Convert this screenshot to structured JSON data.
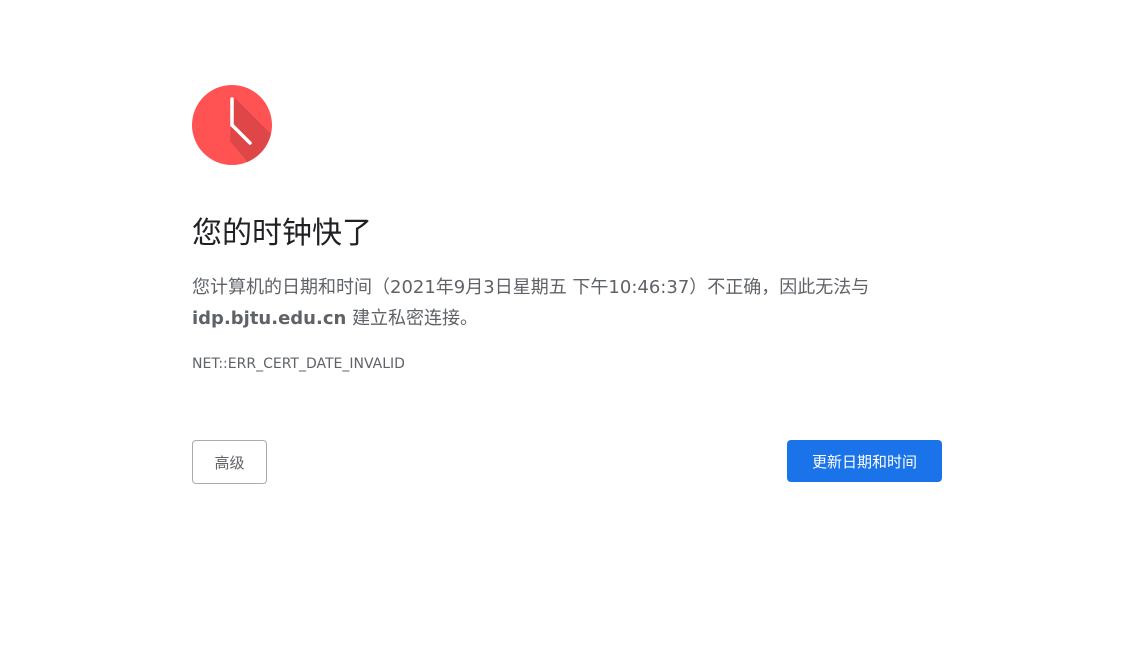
{
  "interstitial": {
    "title": "您的时钟快了",
    "message_part1": "您计算机的日期和时间（2021年9月3日星期五 下午10:46:37）不正确，因此无法与",
    "host": "idp.bjtu.edu.cn",
    "message_part2": "建立私密连接。",
    "error_code": "NET::ERR_CERT_DATE_INVALID",
    "icon": "clock-icon"
  },
  "buttons": {
    "advanced_label": "高级",
    "update_label": "更新日期和时间"
  },
  "colors": {
    "icon_red": "#ff5252",
    "icon_shadow": "#d94447",
    "primary_blue": "#1a73e8",
    "text_dark": "#202124",
    "text_grey": "#5f6368"
  }
}
